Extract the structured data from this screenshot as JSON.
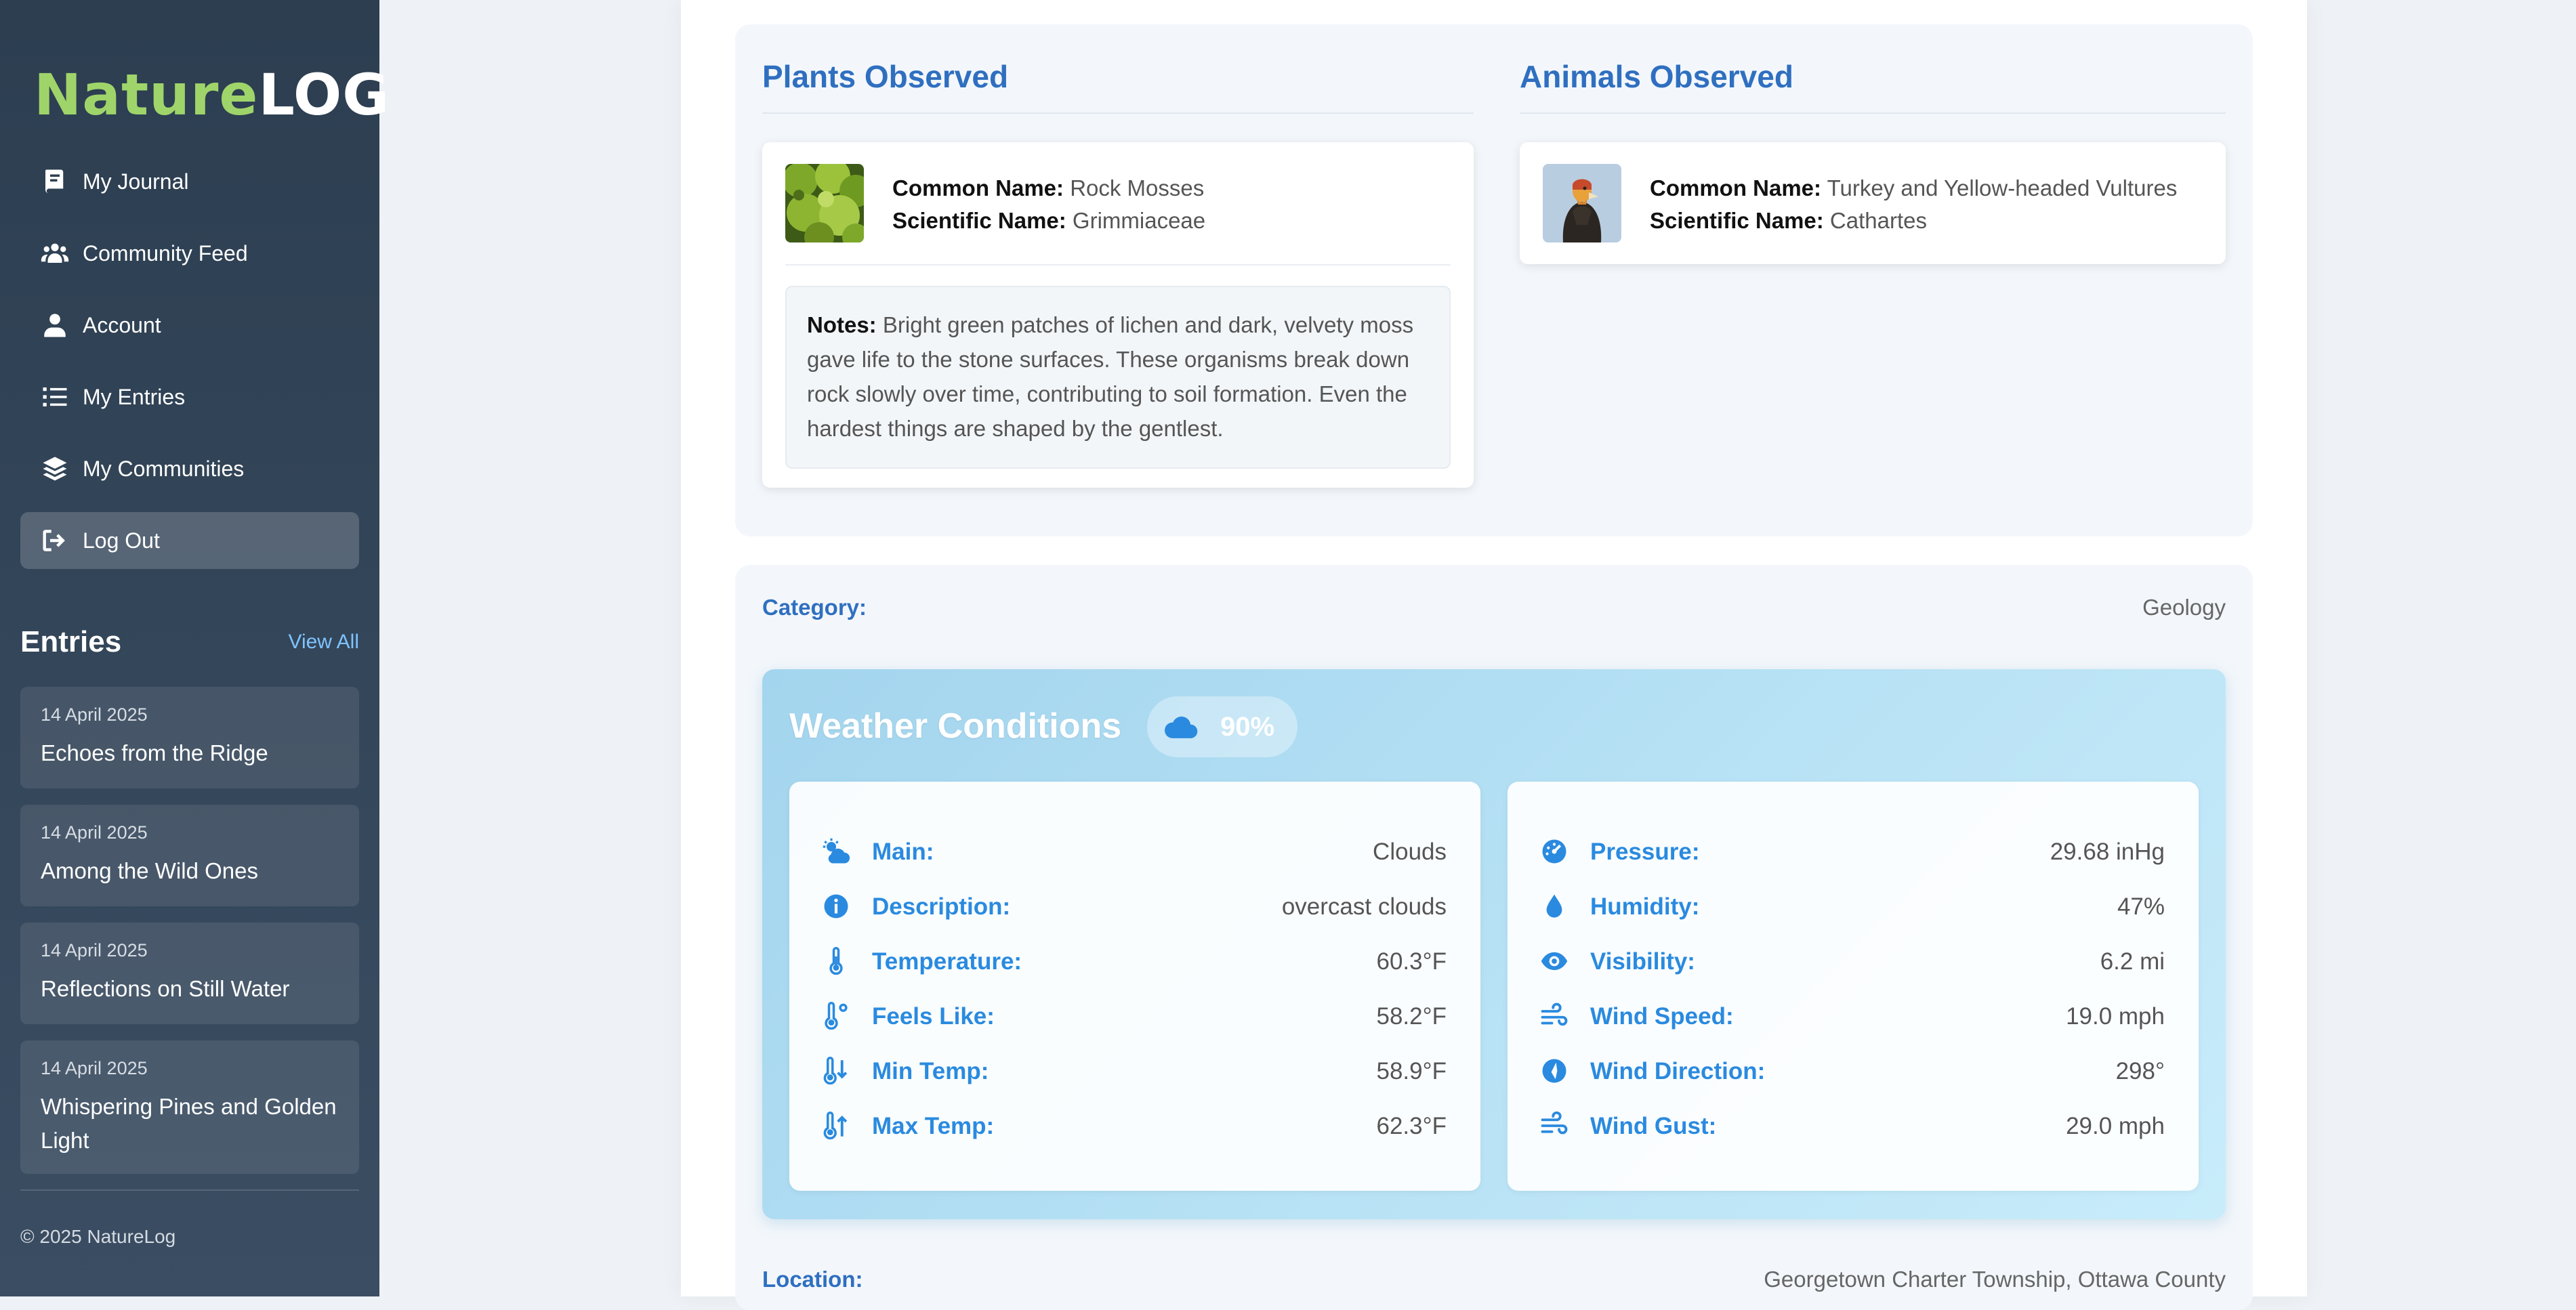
{
  "sidebar": {
    "logo_part1": "Nature",
    "logo_part2": "LOG",
    "nav": [
      {
        "label": "My Journal",
        "icon": "book-icon"
      },
      {
        "label": "Community Feed",
        "icon": "users-icon"
      },
      {
        "label": "Account",
        "icon": "user-icon"
      },
      {
        "label": "My Entries",
        "icon": "list-icon"
      },
      {
        "label": "My Communities",
        "icon": "layers-icon"
      },
      {
        "label": "Log Out",
        "icon": "logout-icon"
      }
    ],
    "entries_title": "Entries",
    "view_all": "View All",
    "entries": [
      {
        "date": "14 April 2025",
        "title": "Echoes from the Ridge"
      },
      {
        "date": "14 April 2025",
        "title": "Among the Wild Ones"
      },
      {
        "date": "14 April 2025",
        "title": "Reflections on Still Water"
      },
      {
        "date": "14 April 2025",
        "title": "Whispering Pines and Golden Light"
      }
    ],
    "copyright": "© 2025 NatureLog"
  },
  "plants": {
    "title": "Plants Observed",
    "common_label": "Common Name:",
    "common_name": "Rock Mosses",
    "sci_label": "Scientific Name:",
    "sci_name": "Grimmiaceae",
    "notes_label": "Notes:",
    "notes": "Bright green patches of lichen and dark, velvety moss gave life to the stone surfaces. These organisms break down rock slowly over time, contributing to soil formation. Even the hardest things are shaped by the gentlest."
  },
  "animals": {
    "title": "Animals Observed",
    "common_label": "Common Name:",
    "common_name": "Turkey and Yellow-headed Vultures",
    "sci_label": "Scientific Name:",
    "sci_name": "Cathartes"
  },
  "info": {
    "category_label": "Category:",
    "category_value": "Geology",
    "location_label": "Location:",
    "location_value": "Georgetown Charter Township, Ottawa County"
  },
  "weather": {
    "title": "Weather Conditions",
    "cloud_pct": "90%",
    "left": [
      {
        "label": "Main:",
        "value": "Clouds",
        "icon": "cloud-sun-icon"
      },
      {
        "label": "Description:",
        "value": "overcast clouds",
        "icon": "info-icon"
      },
      {
        "label": "Temperature:",
        "value": "60.3°F",
        "icon": "thermometer-icon"
      },
      {
        "label": "Feels Like:",
        "value": "58.2°F",
        "icon": "thermometer-degree-icon"
      },
      {
        "label": "Min Temp:",
        "value": "58.9°F",
        "icon": "temp-down-icon"
      },
      {
        "label": "Max Temp:",
        "value": "62.3°F",
        "icon": "temp-up-icon"
      }
    ],
    "right": [
      {
        "label": "Pressure:",
        "value": "29.68 inHg",
        "icon": "gauge-icon"
      },
      {
        "label": "Humidity:",
        "value": "47%",
        "icon": "droplet-icon"
      },
      {
        "label": "Visibility:",
        "value": "6.2 mi",
        "icon": "eye-icon"
      },
      {
        "label": "Wind Speed:",
        "value": "19.0 mph",
        "icon": "wind-icon"
      },
      {
        "label": "Wind Direction:",
        "value": "298°",
        "icon": "compass-icon"
      },
      {
        "label": "Wind Gust:",
        "value": "29.0 mph",
        "icon": "wind-gust-icon"
      }
    ]
  },
  "colors": {
    "sidebar_bg": "#2c3e50",
    "accent_blue": "#2f6fc0",
    "weather_blue": "#2a8adf",
    "logo_green": "#9fd46a"
  }
}
